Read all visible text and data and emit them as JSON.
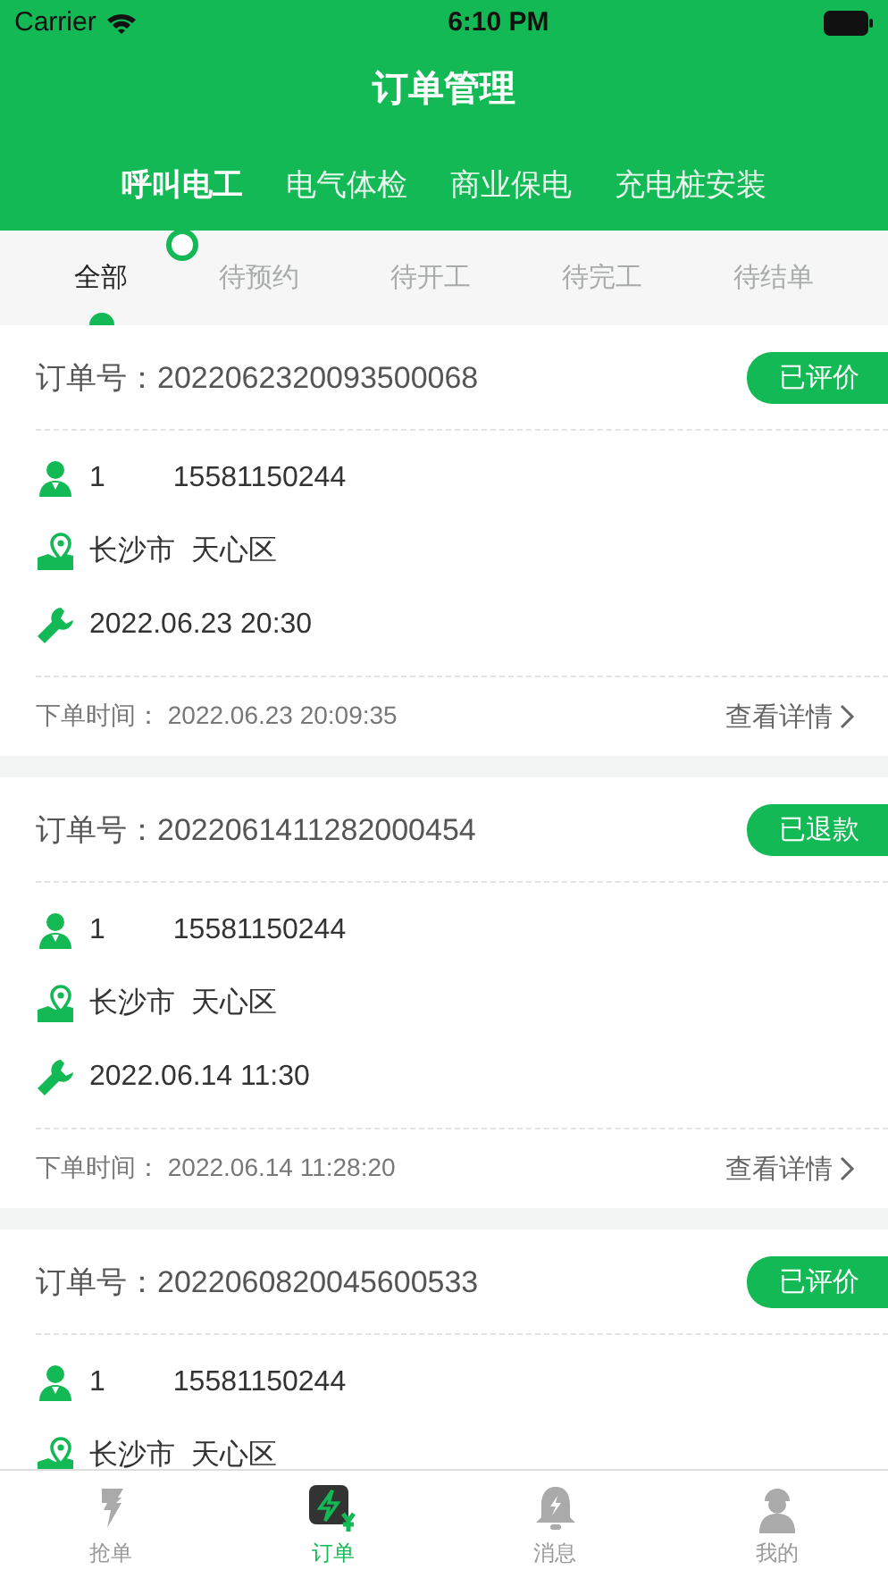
{
  "status_bar": {
    "carrier": "Carrier",
    "time": "6:10 PM"
  },
  "header": {
    "title": "订单管理"
  },
  "categories": [
    {
      "label": "呼叫电工",
      "selected": true
    },
    {
      "label": "电气体检",
      "selected": false
    },
    {
      "label": "商业保电",
      "selected": false
    },
    {
      "label": "充电桩安装",
      "selected": false
    }
  ],
  "filters": [
    {
      "label": "全部",
      "selected": true
    },
    {
      "label": "待预约",
      "selected": false
    },
    {
      "label": "待开工",
      "selected": false
    },
    {
      "label": "待完工",
      "selected": false
    },
    {
      "label": "待结单",
      "selected": false
    }
  ],
  "orders": [
    {
      "order_label": "订单号：",
      "order_no": "2022062320093500068",
      "status": "已评价",
      "name": "1",
      "phone": "15581150244",
      "address": "长沙市  天心区",
      "service_time": "2022.06.23 20:30",
      "created_label": "下单时间：",
      "created": "2022.06.23 20:09:35",
      "details": "查看详情"
    },
    {
      "order_label": "订单号：",
      "order_no": "2022061411282000454",
      "status": "已退款",
      "name": "1",
      "phone": "15581150244",
      "address": "长沙市  天心区",
      "service_time": "2022.06.14 11:30",
      "created_label": "下单时间：",
      "created": "2022.06.14 11:28:20",
      "details": "查看详情"
    },
    {
      "order_label": "订单号：",
      "order_no": "2022060820045600533",
      "status": "已评价",
      "name": "1",
      "phone": "15581150244",
      "address": "长沙市  天心区"
    }
  ],
  "tab_bar": [
    {
      "label": "抢单",
      "kind": "grab",
      "selected": false
    },
    {
      "label": "订单",
      "kind": "orders",
      "selected": true
    },
    {
      "label": "消息",
      "kind": "messages",
      "selected": false
    },
    {
      "label": "我的",
      "kind": "profile",
      "selected": false
    }
  ]
}
